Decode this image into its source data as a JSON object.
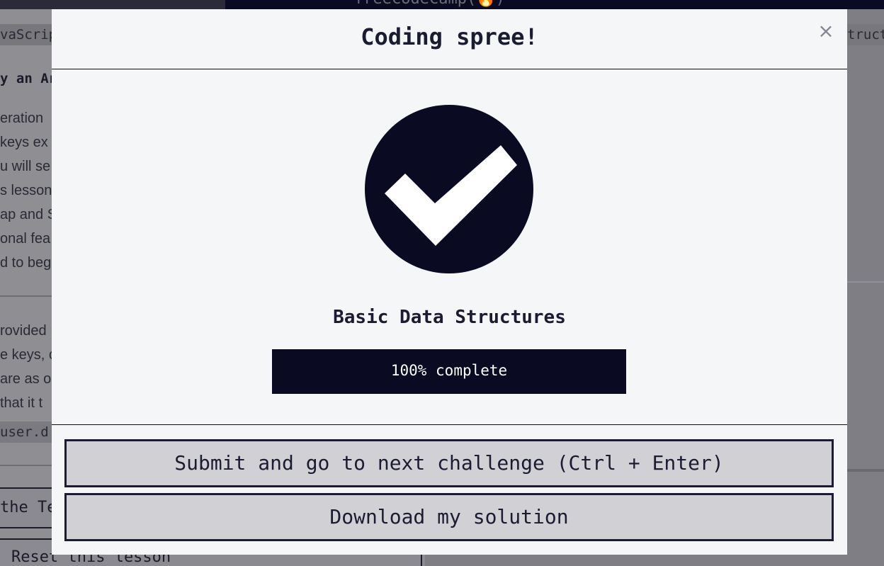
{
  "background": {
    "brand_text": "freeCodeCamp(🔥)",
    "breadcrumb_left": "vaScrip",
    "breadcrumb_right": "truct",
    "heading_fragment": "y an Ar",
    "lines_top": [
      "eration",
      "keys ex",
      "u will se",
      "s lesson",
      "ap and S",
      "onal fea",
      "d to beg"
    ],
    "lines_bottom": [
      "rovided",
      "e keys, c",
      "are as o",
      "that it t"
    ],
    "code_fragment": "user.d",
    "button_fragment": "the Te",
    "reset_button": "Reset this lesson"
  },
  "modal": {
    "title": "Coding spree!",
    "close_label": "×",
    "section_name": "Basic Data Structures",
    "progress_percent": 100,
    "progress_label": "100% complete",
    "submit_button": "Submit and go to next challenge (Ctrl + Enter)",
    "download_button": "Download my solution",
    "icon": "checkmark-circle-icon"
  },
  "colors": {
    "primary_dark": "#0a0a23",
    "modal_bg": "#f5f6f7",
    "button_bg": "#d0d0d5"
  }
}
